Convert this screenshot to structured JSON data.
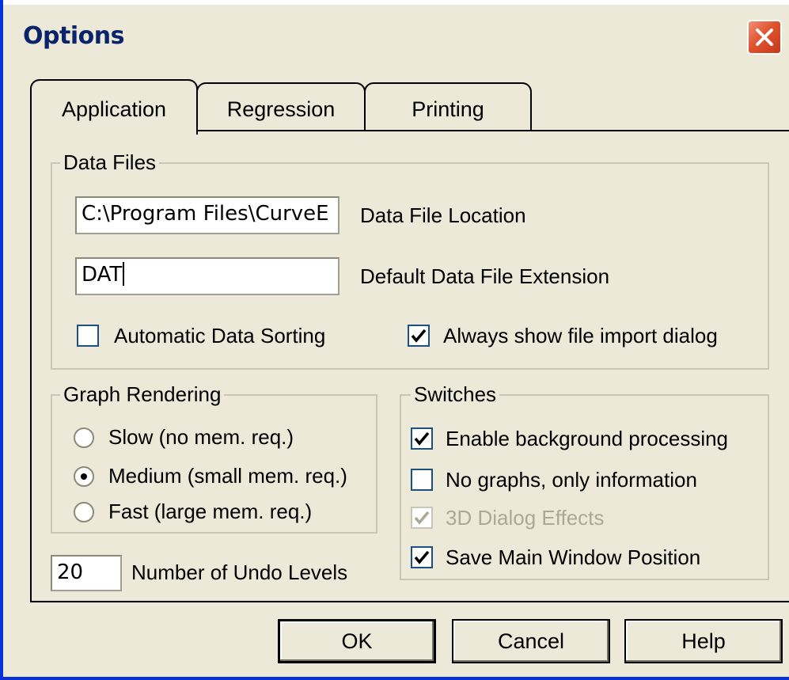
{
  "window": {
    "title": "Options",
    "close_icon": "close-x-icon",
    "titlebar_color": "#0a246a",
    "close_color": "#e0532f"
  },
  "tabs": [
    {
      "label": "Application",
      "selected": true
    },
    {
      "label": "Regression",
      "selected": false
    },
    {
      "label": "Printing",
      "selected": false
    }
  ],
  "data_files": {
    "group_title": "Data Files",
    "location_value": "C:\\Program Files\\CurveE",
    "location_label": "Data File Location",
    "extension_value": "DAT",
    "extension_label": "Default Data File Extension",
    "auto_sort_label": "Automatic Data Sorting",
    "auto_sort_checked": false,
    "import_dialog_label": "Always show file import dialog",
    "import_dialog_checked": true
  },
  "graph_rendering": {
    "group_title": "Graph Rendering",
    "options": [
      {
        "label": "Slow (no mem. req.)",
        "selected": false
      },
      {
        "label": "Medium (small mem. req.)",
        "selected": true
      },
      {
        "label": "Fast (large mem. req.)",
        "selected": false
      }
    ]
  },
  "undo": {
    "value": "20",
    "label": "Number of Undo Levels"
  },
  "switches": {
    "group_title": "Switches",
    "items": [
      {
        "label": "Enable background processing",
        "checked": true,
        "enabled": true
      },
      {
        "label": "No graphs, only information",
        "checked": false,
        "enabled": true
      },
      {
        "label": "3D Dialog Effects",
        "checked": true,
        "enabled": false
      },
      {
        "label": "Save Main Window Position",
        "checked": true,
        "enabled": true
      }
    ]
  },
  "buttons": {
    "ok": "OK",
    "cancel": "Cancel",
    "help": "Help"
  }
}
